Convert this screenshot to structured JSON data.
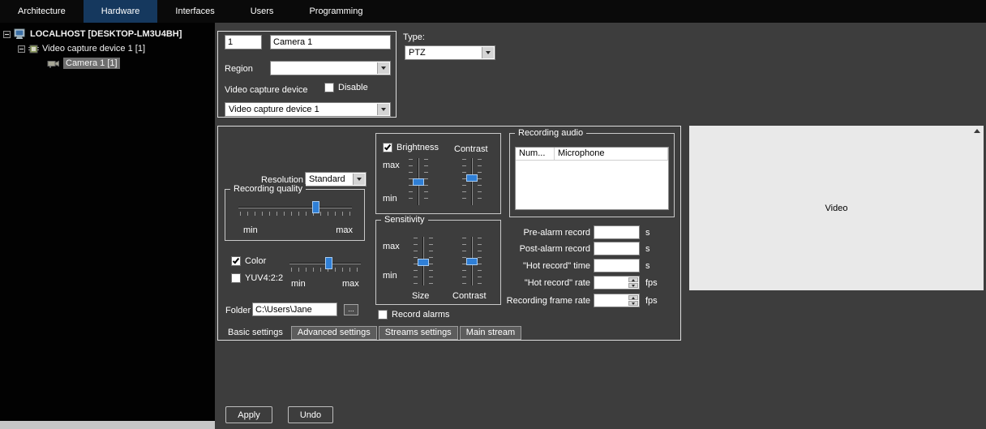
{
  "topbar": {
    "tabs": [
      {
        "label": "Architecture",
        "active": false
      },
      {
        "label": "Hardware",
        "active": true
      },
      {
        "label": "Interfaces",
        "active": false
      },
      {
        "label": "Users",
        "active": false
      },
      {
        "label": "Programming",
        "active": false
      }
    ]
  },
  "tree": {
    "items": [
      {
        "label": "LOCALHOST [DESKTOP-LM3U4BH]"
      },
      {
        "label": "Video capture device 1 [1]"
      },
      {
        "label": "Camera 1 [1]",
        "selected": true
      }
    ]
  },
  "device_panel": {
    "id_value": "1",
    "name_value": "Camera 1",
    "region_label": "Region",
    "region_value": "",
    "device_label": "Video capture device",
    "disable_label": "Disable",
    "device_value": "Video capture device 1"
  },
  "type_section": {
    "label": "Type:",
    "value": "PTZ"
  },
  "settings": {
    "resolution_label": "Resolution",
    "resolution_value": "Standard",
    "recording_quality": {
      "title": "Recording quality",
      "min": "min",
      "max": "max"
    },
    "color_label": "Color",
    "yuv_label": "YUV4:2:2",
    "color_slider": {
      "min": "min",
      "max": "max"
    },
    "folder_label": "Folder",
    "folder_value": "C:\\Users\\Jane",
    "browse_label": "...",
    "brightness_group": {
      "brightness_label": "Brightness",
      "contrast_label": "Contrast",
      "max": "max",
      "min": "min"
    },
    "sensitivity": {
      "title": "Sensitivity",
      "max": "max",
      "min": "min",
      "size_label": "Size",
      "contrast_label": "Contrast"
    },
    "record_alarms_label": "Record alarms",
    "recording_audio": {
      "title": "Recording audio",
      "columns": [
        "Num...",
        "Microphone"
      ]
    },
    "record_fields": [
      {
        "label": "Pre-alarm record",
        "value": "",
        "unit": "s",
        "spinner": false
      },
      {
        "label": "Post-alarm record",
        "value": "",
        "unit": "s",
        "spinner": false
      },
      {
        "label": "\"Hot record\" time",
        "value": "",
        "unit": "s",
        "spinner": false
      },
      {
        "label": "\"Hot record\" rate",
        "value": "",
        "unit": "fps",
        "spinner": true
      },
      {
        "label": "Recording frame rate",
        "value": "",
        "unit": "fps",
        "spinner": true
      }
    ],
    "bottom_tabs": [
      {
        "label": "Basic settings",
        "active": true
      },
      {
        "label": "Advanced settings",
        "active": false
      },
      {
        "label": "Streams settings",
        "active": false
      },
      {
        "label": "Main stream",
        "active": false
      }
    ]
  },
  "video_panel": {
    "label": "Video"
  },
  "footer": {
    "apply_label": "Apply",
    "undo_label": "Undo"
  }
}
